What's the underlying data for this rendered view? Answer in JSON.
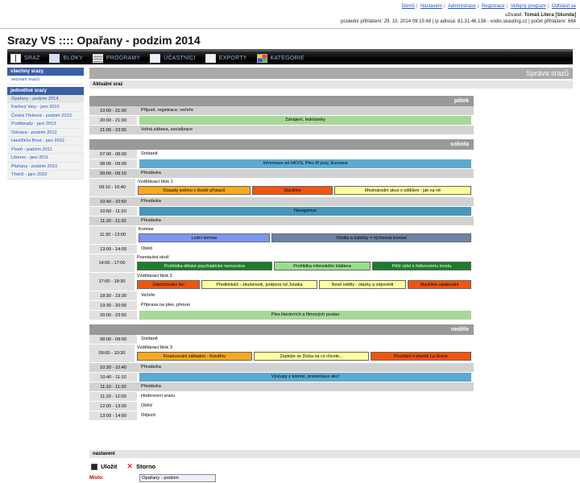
{
  "toplinks": [
    "Domů",
    "Nastavení",
    "Administrace",
    "Registrace",
    "Veřejný program",
    "Odhlásit se"
  ],
  "user": {
    "label": "uživatel:",
    "name": "Tomáš Litera [Skunda]",
    "line2": "poslední přihlášení: 29. 10. 2014 09:15:48 | ip adresa: 81.31.46.138 - vodni.skauting.cz | počet přihlášení: 664"
  },
  "app_title": "Srazy VS :::: Opařany - podzim 2014",
  "menu": [
    "SRAZ",
    "BLOKY",
    "PROGRAMY",
    "ÚČASTNÍCI",
    "EXPORTY",
    "KATEGORIE"
  ],
  "sidebar": {
    "all_header": "všechny srazy",
    "all_link": "seznam srazů",
    "single_header": "jednotlivé srazy",
    "items": [
      "Opařany - podzim 2014",
      "Karlovy Vary - jaro 2010",
      "Česká Třebová - podzim 2013",
      "Poděbrady - jaro 2013",
      "Ostrava - podzim 2012",
      "Havlíčkův Brod - jaro 2012",
      "Plzeň - podzim 2011",
      "Liberec - jaro 2011",
      "Plaňany - podzim 2010",
      "Třebíč - jaro 2010"
    ]
  },
  "page_header": "Správa srazů",
  "current_section": "Aktuální sraz",
  "days": [
    {
      "name": "pátek",
      "rows": [
        {
          "time": "19:00 - 21:00",
          "gray": true,
          "text": "Příjezd, registrace, večeře",
          "style": "plain"
        },
        {
          "time": "20:00 - 21:00",
          "gray": false,
          "text": "Zahájení, ledolamky",
          "style": "green"
        },
        {
          "time": "21:00 - 23:55",
          "gray": true,
          "text": "Volná zábava, socializace",
          "style": "plain"
        }
      ]
    },
    {
      "name": "sobota",
      "rows": [
        {
          "time": "07:00 - 08:00",
          "gray": false,
          "text": "Snídaně",
          "style": "plain"
        },
        {
          "time": "08:00 - 09:00",
          "gray": false,
          "text": "Informace od HKVS, Ples tří jezy, Eurosea",
          "style": "blue"
        },
        {
          "time": "09:00 - 09:10",
          "gray": true,
          "text": "Přestávka",
          "style": "plain"
        },
        {
          "time": "09:10 - 10:40",
          "gray": false,
          "sub": "Vzdělávací blok 1",
          "cells": [
            {
              "text": "Dopady sněmu v životě přístavů",
              "c": "c-orange",
              "w": 140
            },
            {
              "text": "Slackline",
              "c": "c-red",
              "w": 100
            },
            {
              "text": "Mezinárodní akce s oddílem - jak na ně",
              "c": "c-yellow",
              "w": 170
            }
          ]
        },
        {
          "time": "10:40 - 10:50",
          "gray": true,
          "text": "Přestávka",
          "style": "plain"
        },
        {
          "time": "10:50 - 11:20",
          "gray": false,
          "text": "Navigamus",
          "style": "teal"
        },
        {
          "time": "11:20 - 11:30",
          "gray": true,
          "text": "Přestávka",
          "style": "plain"
        },
        {
          "time": "11:30 - 13:00",
          "gray": false,
          "sub": "Komise",
          "cells": [
            {
              "text": "Lodní komise",
              "c": "c-purple",
              "w": 163
            },
            {
              "text": "Včelka a žabičky = výchovná komise",
              "c": "c-slate",
              "w": 248
            }
          ]
        },
        {
          "time": "13:00 - 14:00",
          "gray": false,
          "text": "Oběd",
          "style": "plain"
        },
        {
          "time": "14:00 - 17:00",
          "gray": false,
          "sub": "Poznávání okolí",
          "cells": [
            {
              "text": "Prohlídka dětské psychiatrické nemocnice",
              "c": "c-dkgreen",
              "w": 168
            },
            {
              "text": "Prohlídka milevského kláštera",
              "c": "c-lgreen",
              "w": 120
            },
            {
              "text": "Pěší výlet k řetězovému mostu",
              "c": "c-dkgreen",
              "w": 123
            }
          ]
        },
        {
          "time": "17:00 - 18:30",
          "gray": false,
          "sub": "Vzdělávací blok 2",
          "cells": [
            {
              "text": "Zakončování lan",
              "c": "c-red",
              "w": 78
            },
            {
              "text": "Předklokáči - zkušenosti, podpora od Junáka",
              "c": "c-yellow",
              "w": 144
            },
            {
              "text": "Nové oddíly - otázky a odpovědi",
              "c": "c-yellow",
              "w": 108
            },
            {
              "text": "Slackline opakování",
              "c": "c-red",
              "w": 79
            }
          ]
        },
        {
          "time": "18:30 - 19:30",
          "gray": false,
          "text": "Večeře",
          "style": "plain"
        },
        {
          "time": "19:30 - 20:00",
          "gray": false,
          "text": "Příprava na ples, přesun",
          "style": "plain"
        },
        {
          "time": "20:00 - 23:55",
          "gray": false,
          "text": "Ples literárních a filmových postav",
          "style": "green"
        }
      ]
    },
    {
      "name": "neděle",
      "rows": [
        {
          "time": "08:00 - 09:00",
          "gray": false,
          "text": "Snídaně",
          "style": "plain"
        },
        {
          "time": "09:00 - 10:30",
          "gray": false,
          "sub": "Vzdělávací blok 3",
          "cells": [
            {
              "text": "Financování základen - Kovářov",
              "c": "c-orange",
              "w": 143
            },
            {
              "text": "Zeptejte se Dicka na co chcete...",
              "c": "c-yellow",
              "w": 143
            },
            {
              "text": "Povídání o plavbě La Grace",
              "c": "c-red",
              "w": 125
            }
          ]
        },
        {
          "time": "10:30 - 10:40",
          "gray": true,
          "text": "Přestávka",
          "style": "plain"
        },
        {
          "time": "10:40 - 11:10",
          "gray": false,
          "text": "Výstupy z komisí, prezentace akcí",
          "style": "blue"
        },
        {
          "time": "11:10 - 11:20",
          "gray": true,
          "text": "Přestávka",
          "style": "plain"
        },
        {
          "time": "11:20 - 12:00",
          "gray": false,
          "text": "Hodnocení srazu",
          "style": "plain"
        },
        {
          "time": "12:00 - 13:00",
          "gray": false,
          "text": "Oběd",
          "style": "plain"
        },
        {
          "time": "13:00 - 14:00",
          "gray": false,
          "text": "Odjezd",
          "style": "plain"
        }
      ]
    }
  ],
  "settings": {
    "header": "nastavení",
    "save": "Uložit",
    "cancel": "Storno",
    "place_label": "Místo:",
    "place_value": "Opařany - podzim"
  }
}
